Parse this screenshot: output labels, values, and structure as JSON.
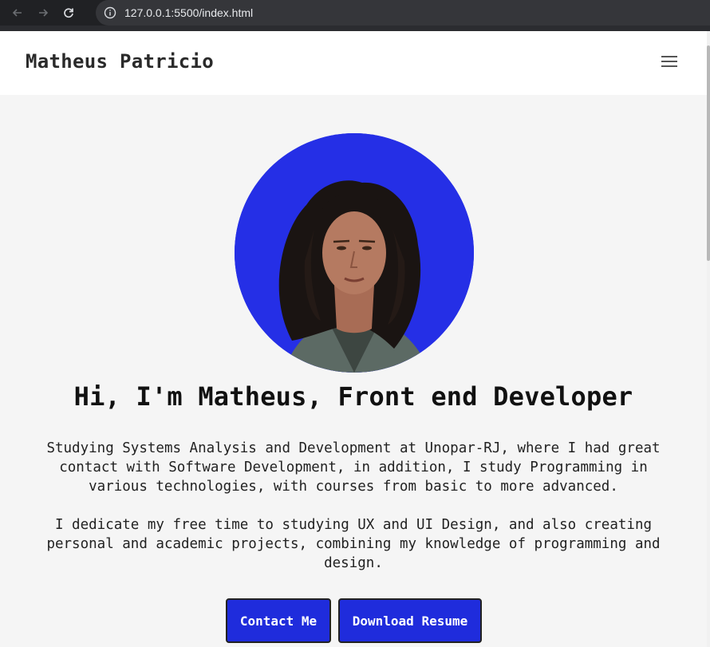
{
  "browser": {
    "url": "127.0.0.1:5500/index.html",
    "back_icon": "arrow-left-icon",
    "forward_icon": "arrow-right-icon",
    "reload_icon": "reload-icon",
    "info_icon": "info-icon"
  },
  "header": {
    "brand": "Matheus Patricio",
    "menu_icon": "hamburger-menu-icon"
  },
  "hero": {
    "avatar_alt": "profile photo",
    "headline": "Hi, I'm Matheus, Front end Developer",
    "bio_paragraph_1": "Studying Systems Analysis and Development at Unopar-RJ, where I had great contact with Software Development, in addition, I study Programming in various technologies, with courses from basic to more advanced.",
    "bio_paragraph_2": "I dedicate my free time to studying UX and UI Design, and also creating personal and academic projects, combining my knowledge of programming and design.",
    "buttons": {
      "contact": "Contact Me",
      "resume": "Download Resume"
    }
  },
  "colors": {
    "accent": "#1f2cdc",
    "avatar_bg": "#252fe6",
    "page_bg": "#f5f5f5",
    "browser_bar": "#202124"
  }
}
